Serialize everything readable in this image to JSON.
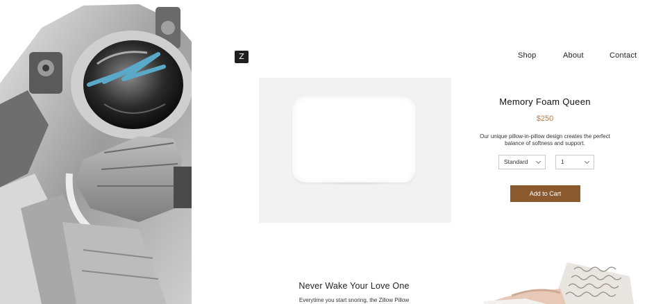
{
  "header": {
    "logo_text": "Z",
    "nav": [
      "Shop",
      "About",
      "Contact"
    ]
  },
  "product": {
    "title": "Memory Foam Queen",
    "price": "$250",
    "description": "Our unique pillow-in-pillow design creates the perfect balance of softness and support.",
    "size_select": {
      "value": "Standard"
    },
    "quantity_select": {
      "value": "1"
    },
    "add_to_cart_label": "Add to Cart"
  },
  "section": {
    "title": "Never Wake Your Love One",
    "text": "Everytime you start snoring, the Zillow Pillow"
  },
  "colors": {
    "accent_price": "#b07a4a",
    "button": "#8a5a2e",
    "scribble": "#5aa9c9"
  }
}
